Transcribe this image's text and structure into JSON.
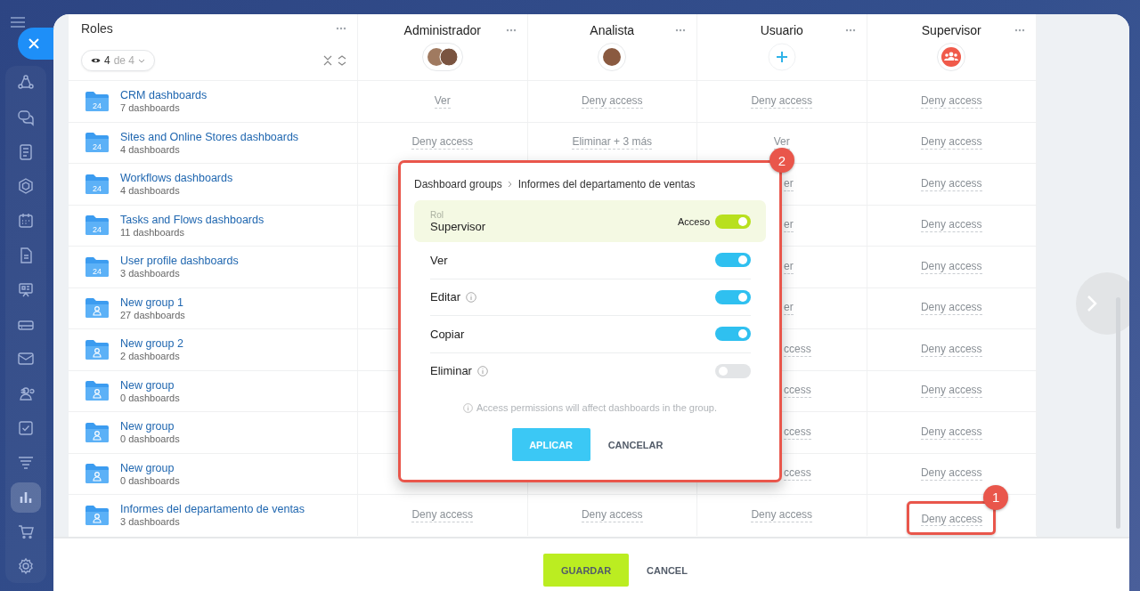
{
  "sidebar": {
    "items": [
      {
        "kind": "network",
        "selected": false
      },
      {
        "kind": "chat",
        "selected": false
      },
      {
        "kind": "feed",
        "selected": false
      },
      {
        "kind": "hexagon",
        "selected": false
      },
      {
        "kind": "calendar",
        "selected": false
      },
      {
        "kind": "document",
        "selected": false
      },
      {
        "kind": "board",
        "selected": false
      },
      {
        "kind": "drive",
        "selected": false
      },
      {
        "kind": "mail",
        "selected": false
      },
      {
        "kind": "contacts",
        "selected": false
      },
      {
        "kind": "tasks",
        "selected": false
      },
      {
        "kind": "filter",
        "selected": false
      },
      {
        "kind": "chart",
        "selected": true
      },
      {
        "kind": "cart",
        "selected": false
      },
      {
        "kind": "settings",
        "selected": false
      }
    ]
  },
  "roles_header": {
    "title": "Roles",
    "filter_count": "4",
    "filter_total": "de 4"
  },
  "columns": [
    {
      "title": "Administrador",
      "kind": "people"
    },
    {
      "title": "Analista",
      "kind": "person"
    },
    {
      "title": "Usuario",
      "kind": "add"
    },
    {
      "title": "Supervisor",
      "kind": "group"
    }
  ],
  "rows": [
    {
      "name": "CRM dashboards",
      "count": "7 dashboards",
      "folder_label": "24",
      "cells": [
        {
          "text": "Ver",
          "clipped": false
        },
        {
          "text": "Deny access",
          "clipped": false
        },
        {
          "text": "Deny access",
          "clipped": false
        },
        {
          "text": "Deny access",
          "clipped": false
        }
      ]
    },
    {
      "name": "Sites and Online Stores dashboards",
      "count": "4 dashboards",
      "folder_label": "24",
      "cells": [
        {
          "text": "Deny access",
          "clipped": false
        },
        {
          "text": "Eliminar + 3 más",
          "clipped": false
        },
        {
          "text": "Ver",
          "clipped": false
        },
        {
          "text": "Deny access",
          "clipped": false
        }
      ]
    },
    {
      "name": "Workflows dashboards",
      "count": "4 dashboards",
      "folder_label": "24",
      "cells": [
        null,
        null,
        {
          "text": "er",
          "clipped": true
        },
        {
          "text": "Deny access",
          "clipped": false
        }
      ]
    },
    {
      "name": "Tasks and Flows dashboards",
      "count": "11 dashboards",
      "folder_label": "24",
      "cells": [
        null,
        null,
        {
          "text": "er",
          "clipped": true
        },
        {
          "text": "Deny access",
          "clipped": false
        }
      ]
    },
    {
      "name": "User profile dashboards",
      "count": "3 dashboards",
      "folder_label": "24",
      "cells": [
        null,
        null,
        {
          "text": "er",
          "clipped": true
        },
        {
          "text": "Deny access",
          "clipped": false
        }
      ]
    },
    {
      "name": "New group 1",
      "count": "27 dashboards",
      "cells": [
        null,
        null,
        {
          "text": "er",
          "clipped": true
        },
        {
          "text": "Deny access",
          "clipped": false
        }
      ]
    },
    {
      "name": "New group 2",
      "count": "2 dashboards",
      "cells": [
        null,
        null,
        {
          "text": "ccess",
          "clipped": true
        },
        {
          "text": "Deny access",
          "clipped": false
        }
      ]
    },
    {
      "name": "New group",
      "count": "0 dashboards",
      "cells": [
        null,
        null,
        {
          "text": "ccess",
          "clipped": true
        },
        {
          "text": "Deny access",
          "clipped": false
        }
      ]
    },
    {
      "name": "New group",
      "count": "0 dashboards",
      "cells": [
        null,
        null,
        {
          "text": "ccess",
          "clipped": true
        },
        {
          "text": "Deny access",
          "clipped": false
        }
      ]
    },
    {
      "name": "New group",
      "count": "0 dashboards",
      "cells": [
        null,
        null,
        {
          "text": "ccess",
          "clipped": true
        },
        {
          "text": "Deny access",
          "clipped": false
        }
      ]
    },
    {
      "name": "Informes del departamento de ventas",
      "count": "3 dashboards",
      "cells": [
        {
          "text": "Deny access",
          "clipped": false
        },
        {
          "text": "Deny access",
          "clipped": false
        },
        {
          "text": "Deny access",
          "clipped": false
        },
        {
          "text": "Deny access",
          "clipped": false,
          "marker": "1"
        }
      ]
    }
  ],
  "popup": {
    "marker": "2",
    "breadcrumb": [
      "Dashboard groups",
      "Informes del departamento de ventas"
    ],
    "role_label": "Rol",
    "role": "Supervisor",
    "access_label": "Acceso",
    "access_on": true,
    "permissions": [
      {
        "label": "Ver",
        "info": false,
        "on": true
      },
      {
        "label": "Editar",
        "info": true,
        "on": true
      },
      {
        "label": "Copiar",
        "info": false,
        "on": true
      },
      {
        "label": "Eliminar",
        "info": true,
        "on": false
      }
    ],
    "note": "Access permissions will affect dashboards in the group.",
    "apply": "APLICAR",
    "cancel": "CANCELAR"
  },
  "footer": {
    "save": "GUARDAR",
    "cancel": "CANCEL"
  }
}
